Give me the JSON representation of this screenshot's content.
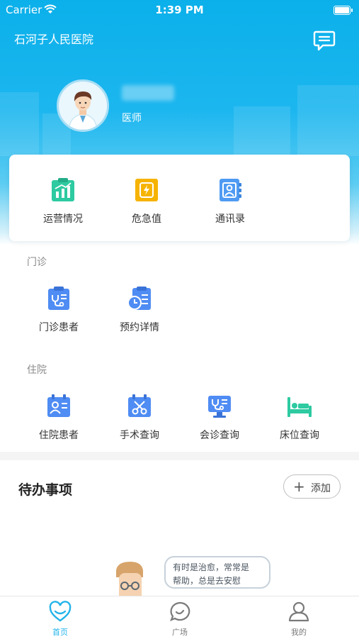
{
  "status_bar": {
    "carrier": "Carrier",
    "time": "1:39 PM"
  },
  "header": {
    "hospital_name": "石河子人民医院",
    "role": "医师",
    "name_blurred": true
  },
  "quick_actions": [
    {
      "label": "运营情况",
      "icon": "operations-chart-icon",
      "color": "#2ecaa1"
    },
    {
      "label": "危急值",
      "icon": "critical-value-icon",
      "color": "#f6b300"
    },
    {
      "label": "通讯录",
      "icon": "contacts-book-icon",
      "color": "#4f9bf3"
    }
  ],
  "outpatient": {
    "title": "门诊",
    "items": [
      {
        "label": "门诊患者",
        "icon": "outpatient-clipboard-icon"
      },
      {
        "label": "预约详情",
        "icon": "appointment-clock-icon"
      }
    ]
  },
  "inpatient": {
    "title": "住院",
    "items": [
      {
        "label": "住院患者",
        "icon": "inpatient-card-icon"
      },
      {
        "label": "手术查询",
        "icon": "surgery-scissors-icon"
      },
      {
        "label": "会诊查询",
        "icon": "consultation-monitor-icon"
      },
      {
        "label": "床位查询",
        "icon": "hospital-bed-icon"
      }
    ]
  },
  "todo": {
    "title": "待办事项",
    "add_label": "添加",
    "quote_line1": "有时是治愈，常常是",
    "quote_line2": "帮助，总是去安慰"
  },
  "tabbar": [
    {
      "label": "首页",
      "icon": "heart-home-icon",
      "active": true
    },
    {
      "label": "广场",
      "icon": "chat-bubble-icon",
      "active": false
    },
    {
      "label": "我的",
      "icon": "user-profile-icon",
      "active": false
    }
  ],
  "colors": {
    "primary": "#19b4ec",
    "icon_blue": "#4f8cf3",
    "bed_green": "#2ecaa1",
    "warning": "#f6b300",
    "tab_active": "#22b3ea",
    "tab_inactive": "#7a7a7a"
  }
}
